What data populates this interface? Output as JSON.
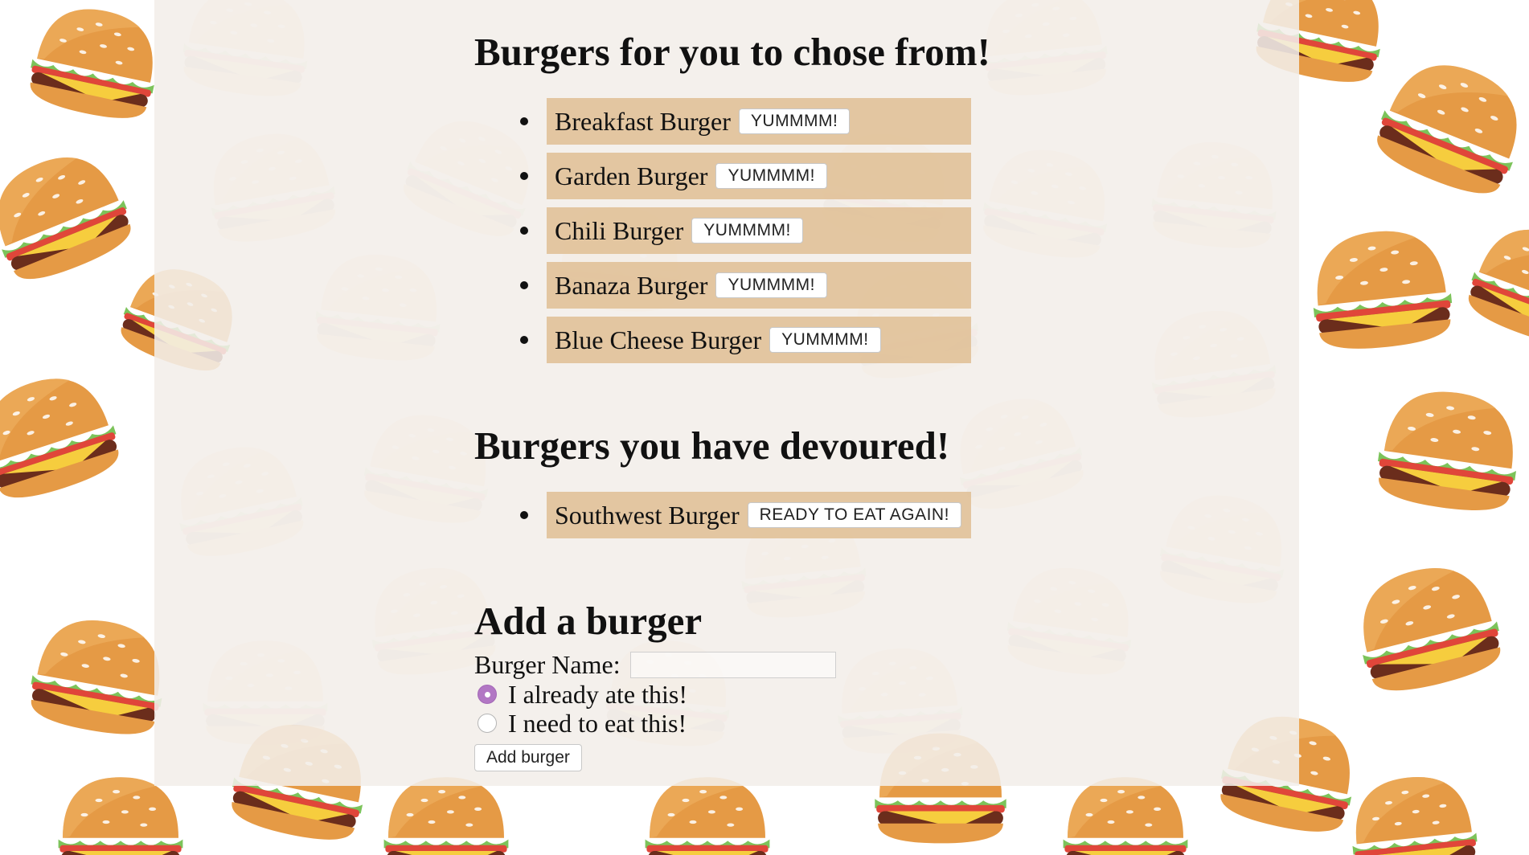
{
  "sections": {
    "available_title": "Burgers for you to chose from!",
    "devoured_title": "Burgers you have devoured!",
    "add_title": "Add a burger"
  },
  "available_burgers": [
    {
      "name": "Breakfast Burger",
      "action": "YUMMMM!"
    },
    {
      "name": "Garden Burger",
      "action": "YUMMMM!"
    },
    {
      "name": "Chili Burger",
      "action": "YUMMMM!"
    },
    {
      "name": "Banaza Burger",
      "action": "YUMMMM!"
    },
    {
      "name": "Blue Cheese Burger",
      "action": "YUMMMM!"
    }
  ],
  "devoured_burgers": [
    {
      "name": "Southwest Burger",
      "action": "READY TO EAT AGAIN!"
    }
  ],
  "form": {
    "name_label": "Burger Name:",
    "name_value": "",
    "radio_ate_label": "I already ate this!",
    "radio_ate_checked": true,
    "radio_need_label": "I need to eat this!",
    "radio_need_checked": false,
    "submit_label": "Add burger"
  },
  "background": {
    "icon": "hamburger-icon",
    "page_color": "#ffffff",
    "panel_color": "#f2eee9",
    "item_box_color": "#deba8c",
    "radio_accent": "#b277c4"
  }
}
